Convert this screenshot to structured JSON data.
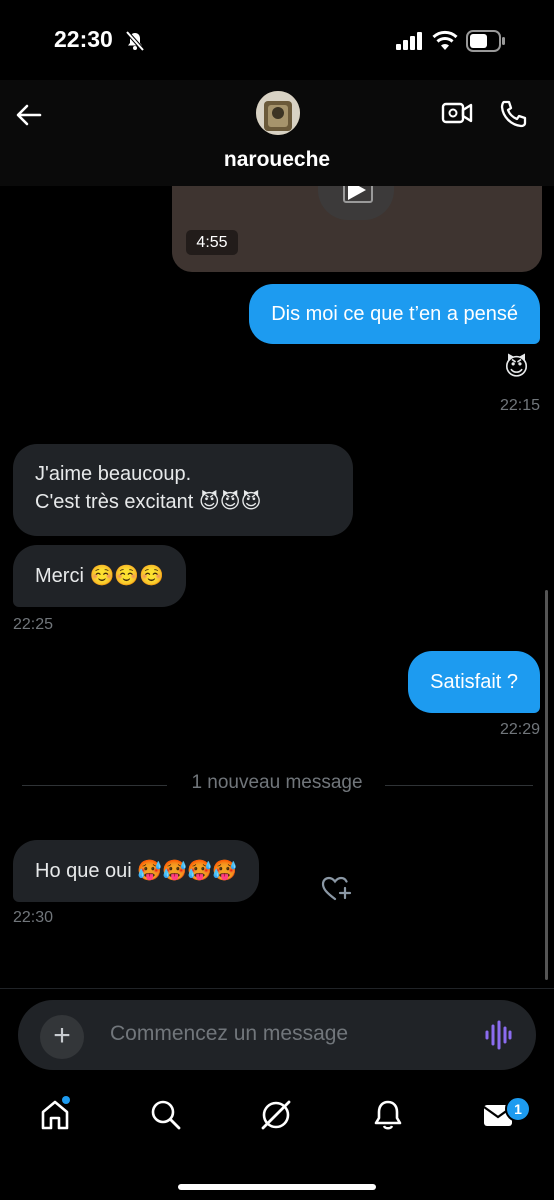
{
  "status_bar": {
    "time": "22:30"
  },
  "header": {
    "username": "naroueche"
  },
  "media": {
    "duration": "4:55"
  },
  "messages": [
    {
      "text": "Dis moi ce que t’en a pensé",
      "reaction": "😈",
      "time": "22:15"
    },
    {
      "line1": "J'aime beaucoup.",
      "line2": "C'est très excitant 😈😈😈"
    },
    {
      "text": "Merci ☺️☺️☺️",
      "time": "22:25"
    },
    {
      "text": "Satisfait ?",
      "time": "22:29"
    },
    {
      "text": "Ho que oui 🥵🥵🥵🥵",
      "time": "22:30"
    }
  ],
  "divider": {
    "label": "1 nouveau message"
  },
  "composer": {
    "placeholder": "Commencez un message",
    "plus_label": "+"
  },
  "tabbar": {
    "messages_badge": "1"
  },
  "colors": {
    "accent": "#1d9bf0",
    "incoming_bubble": "#202327",
    "background": "#000000"
  },
  "icons": [
    "back-arrow-icon",
    "video-call-icon",
    "phone-icon",
    "play-icon",
    "heart-add-icon",
    "plus-icon",
    "voice-icon",
    "home-icon",
    "search-icon",
    "grok-icon",
    "bell-icon",
    "mail-icon"
  ]
}
